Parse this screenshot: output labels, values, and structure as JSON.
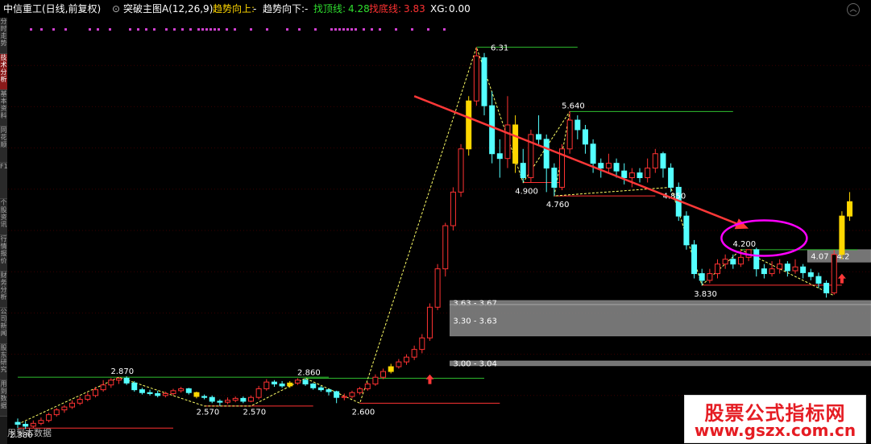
{
  "header": {
    "stock": "中信重工(日线,前复权)",
    "indicator": "突破主图A(12,26,9)",
    "trend_up_label": "趋势向上:",
    "trend_up_value": "-",
    "trend_down_label": "趋势向下:",
    "trend_down_value": "-",
    "top_line_label": "找顶线:",
    "top_line_value": "4.28",
    "bottom_line_label": "找底线:",
    "bottom_line_value": "3.83",
    "xg_label": "XG:",
    "xg_value": "0.00"
  },
  "sidebar_tabs": [
    "分时走势",
    "技术分析",
    "基本资料",
    "同花顺",
    "F10",
    "个股资讯",
    "行情报价",
    "财务分析",
    "公司新闻",
    "股东研究",
    "用到数据"
  ],
  "status_text": "用到本数据",
  "watermark": {
    "line1": "股票公式指标网",
    "line2": "www.gszx.com.cn"
  },
  "colors": {
    "up": "#ff3232",
    "down": "#54ffff",
    "signal": "#ffd700",
    "support": "#ff3232",
    "resistance": "#2fbf2f",
    "zigzag": "#ffff66",
    "arrow": "#ff3838",
    "ellipse": "#ff00ff",
    "box": "#8a8a8a"
  },
  "chart_data": {
    "type": "candlestick",
    "ylim": [
      2.25,
      6.55
    ],
    "candles": [
      [
        2.4,
        2.38,
        2.44,
        2.34
      ],
      [
        2.38,
        2.36,
        2.41,
        2.33
      ],
      [
        2.36,
        2.39,
        2.42,
        2.34
      ],
      [
        2.39,
        2.42,
        2.45,
        2.37
      ],
      [
        2.42,
        2.48,
        2.5,
        2.4
      ],
      [
        2.48,
        2.53,
        2.55,
        2.46
      ],
      [
        2.53,
        2.56,
        2.58,
        2.5
      ],
      [
        2.56,
        2.6,
        2.63,
        2.54
      ],
      [
        2.6,
        2.64,
        2.67,
        2.58
      ],
      [
        2.64,
        2.68,
        2.71,
        2.62
      ],
      [
        2.68,
        2.74,
        2.77,
        2.66
      ],
      [
        2.74,
        2.79,
        2.84,
        2.72
      ],
      [
        2.79,
        2.84,
        2.86,
        2.76
      ],
      [
        2.84,
        2.86,
        2.87,
        2.8
      ],
      [
        2.86,
        2.81,
        2.88,
        2.79
      ],
      [
        2.81,
        2.74,
        2.83,
        2.72
      ],
      [
        2.74,
        2.71,
        2.76,
        2.69
      ],
      [
        2.71,
        2.7,
        2.74,
        2.68
      ],
      [
        2.7,
        2.68,
        2.73,
        2.66
      ],
      [
        2.68,
        2.7,
        2.72,
        2.66
      ],
      [
        2.7,
        2.73,
        2.75,
        2.68
      ],
      [
        2.73,
        2.75,
        2.77,
        2.71
      ],
      [
        2.75,
        2.71,
        2.76,
        2.69
      ],
      [
        2.71,
        2.67,
        2.72,
        2.65
      ],
      [
        2.67,
        2.66,
        2.69,
        2.64
      ],
      [
        2.66,
        2.62,
        2.68,
        2.6
      ],
      [
        2.62,
        2.61,
        2.64,
        2.57
      ],
      [
        2.61,
        2.63,
        2.66,
        2.59
      ],
      [
        2.63,
        2.65,
        2.67,
        2.61
      ],
      [
        2.65,
        2.62,
        2.67,
        2.6
      ],
      [
        2.62,
        2.66,
        2.68,
        2.61
      ],
      [
        2.66,
        2.75,
        2.78,
        2.64
      ],
      [
        2.75,
        2.82,
        2.85,
        2.73
      ],
      [
        2.82,
        2.8,
        2.84,
        2.77
      ],
      [
        2.8,
        2.78,
        2.83,
        2.76
      ],
      [
        2.78,
        2.81,
        2.83,
        2.76
      ],
      [
        2.81,
        2.84,
        2.86,
        2.79
      ],
      [
        2.84,
        2.8,
        2.86,
        2.78
      ],
      [
        2.8,
        2.76,
        2.81,
        2.74
      ],
      [
        2.76,
        2.74,
        2.78,
        2.72
      ],
      [
        2.74,
        2.72,
        2.75,
        2.68
      ],
      [
        2.72,
        2.66,
        2.73,
        2.6
      ],
      [
        2.66,
        2.67,
        2.7,
        2.63
      ],
      [
        2.67,
        2.71,
        2.73,
        2.65
      ],
      [
        2.71,
        2.75,
        2.77,
        2.69
      ],
      [
        2.75,
        2.8,
        2.82,
        2.73
      ],
      [
        2.8,
        2.87,
        2.9,
        2.78
      ],
      [
        2.87,
        2.93,
        2.96,
        2.85
      ],
      [
        2.93,
        2.98,
        3.01,
        2.91
      ],
      [
        2.98,
        3.03,
        3.06,
        2.96
      ],
      [
        3.03,
        3.08,
        3.11,
        3.0
      ],
      [
        3.08,
        3.16,
        3.2,
        3.05
      ],
      [
        3.16,
        3.28,
        3.32,
        3.12
      ],
      [
        3.28,
        3.6,
        3.64,
        3.25
      ],
      [
        3.6,
        4.0,
        4.05,
        3.57
      ],
      [
        4.0,
        4.45,
        4.48,
        3.92
      ],
      [
        4.45,
        4.8,
        4.85,
        4.4
      ],
      [
        4.8,
        5.25,
        5.3,
        4.75
      ],
      [
        5.25,
        5.75,
        5.8,
        5.18
      ],
      [
        5.75,
        6.22,
        6.31,
        5.7
      ],
      [
        6.2,
        5.7,
        6.25,
        5.6
      ],
      [
        5.7,
        5.2,
        5.85,
        5.1
      ],
      [
        5.2,
        5.15,
        5.35,
        4.95
      ],
      [
        5.15,
        5.5,
        5.8,
        5.05
      ],
      [
        5.5,
        5.1,
        5.6,
        5.0
      ],
      [
        5.1,
        4.95,
        5.25,
        4.9
      ],
      [
        4.95,
        5.4,
        5.45,
        4.9
      ],
      [
        5.4,
        5.35,
        5.6,
        5.3
      ],
      [
        5.35,
        5.05,
        5.4,
        4.8
      ],
      [
        5.05,
        4.85,
        5.1,
        4.76
      ],
      [
        4.85,
        5.25,
        5.3,
        4.82
      ],
      [
        5.25,
        5.55,
        5.64,
        5.2
      ],
      [
        5.55,
        5.45,
        5.6,
        5.35
      ],
      [
        5.45,
        5.3,
        5.5,
        5.2
      ],
      [
        5.3,
        5.1,
        5.35,
        5.0
      ],
      [
        5.1,
        5.05,
        5.15,
        4.95
      ],
      [
        5.05,
        5.1,
        5.2,
        5.0
      ],
      [
        5.1,
        5.02,
        5.15,
        4.95
      ],
      [
        5.02,
        4.95,
        5.1,
        4.88
      ],
      [
        4.95,
        5.0,
        5.05,
        4.85
      ],
      [
        5.0,
        4.95,
        5.05,
        4.9
      ],
      [
        4.95,
        5.05,
        5.15,
        4.9
      ],
      [
        5.05,
        5.2,
        5.25,
        5.0
      ],
      [
        5.2,
        5.05,
        5.22,
        4.95
      ],
      [
        5.05,
        4.85,
        5.1,
        4.8
      ],
      [
        4.85,
        4.55,
        4.9,
        4.5
      ],
      [
        4.55,
        4.25,
        4.6,
        4.2
      ],
      [
        4.25,
        3.95,
        4.3,
        3.9
      ],
      [
        3.95,
        3.88,
        4.0,
        3.83
      ],
      [
        3.88,
        3.95,
        4.0,
        3.85
      ],
      [
        3.95,
        4.05,
        4.1,
        3.9
      ],
      [
        4.05,
        4.1,
        4.15,
        4.0
      ],
      [
        4.1,
        4.05,
        4.15,
        4.0
      ],
      [
        4.05,
        4.12,
        4.2,
        4.02
      ],
      [
        4.12,
        4.2,
        4.2,
        4.08
      ],
      [
        4.2,
        4.0,
        4.22,
        3.92
      ],
      [
        4.0,
        3.95,
        4.05,
        3.9
      ],
      [
        3.95,
        4.0,
        4.08,
        3.92
      ],
      [
        4.0,
        4.05,
        4.1,
        3.95
      ],
      [
        4.05,
        3.98,
        4.08,
        3.92
      ],
      [
        3.98,
        4.02,
        4.1,
        3.95
      ],
      [
        4.02,
        3.96,
        4.05,
        3.9
      ],
      [
        3.96,
        3.92,
        4.0,
        3.88
      ],
      [
        3.92,
        3.85,
        3.96,
        3.8
      ],
      [
        3.85,
        3.75,
        3.88,
        3.7
      ],
      [
        3.75,
        4.15,
        4.2,
        3.73
      ],
      [
        4.15,
        4.55,
        4.6,
        4.1
      ],
      [
        4.55,
        4.7,
        4.8,
        4.5
      ]
    ],
    "signal_candles": [
      23,
      35,
      48,
      58,
      64,
      106,
      107
    ],
    "price_labels": [
      {
        "text": "2.380",
        "i": 0,
        "p": 2.36,
        "pos": "below"
      },
      {
        "text": "2.870",
        "i": 13,
        "p": 2.87,
        "pos": "above"
      },
      {
        "text": "2.570",
        "i": 24,
        "p": 2.6,
        "pos": "below"
      },
      {
        "text": "2.570",
        "i": 30,
        "p": 2.6,
        "pos": "below"
      },
      {
        "text": "2.860",
        "i": 37,
        "p": 2.86,
        "pos": "above"
      },
      {
        "text": "2.600",
        "i": 44,
        "p": 2.6,
        "pos": "below"
      },
      {
        "text": "6.31",
        "i": 60,
        "p": 6.31,
        "pos": "right"
      },
      {
        "text": "4.900",
        "i": 65,
        "p": 4.9,
        "pos": "below"
      },
      {
        "text": "5.640",
        "i": 71,
        "p": 5.64,
        "pos": "above"
      },
      {
        "text": "4.760",
        "i": 69,
        "p": 4.76,
        "pos": "below"
      },
      {
        "text": "4.850",
        "i": 84,
        "p": 4.85,
        "pos": "below"
      },
      {
        "text": "4.200",
        "i": 93,
        "p": 4.2,
        "pos": "above"
      },
      {
        "text": "3.830",
        "i": 88,
        "p": 3.83,
        "pos": "below"
      }
    ],
    "zigzag": [
      [
        0,
        2.38
      ],
      [
        13,
        2.87
      ],
      [
        24,
        2.57
      ],
      [
        30,
        2.57
      ],
      [
        37,
        2.86
      ],
      [
        44,
        2.6
      ],
      [
        59,
        6.31
      ],
      [
        65,
        4.9
      ],
      [
        71,
        5.64
      ],
      [
        69,
        4.76
      ],
      [
        84,
        4.85
      ],
      [
        88,
        3.83
      ],
      [
        93,
        4.2
      ],
      [
        105,
        3.72
      ]
    ],
    "resistance_lines": [
      [
        0,
        2.87,
        40
      ],
      [
        37,
        2.86,
        60
      ],
      [
        59,
        6.31,
        72
      ],
      [
        71,
        5.64,
        92
      ],
      [
        93,
        4.2,
        108
      ]
    ],
    "support_lines": [
      [
        0,
        2.34,
        20
      ],
      [
        24,
        2.57,
        38
      ],
      [
        44,
        2.6,
        62
      ],
      [
        65,
        4.9,
        70
      ],
      [
        69,
        4.76,
        82
      ],
      [
        88,
        3.83,
        106
      ]
    ],
    "price_zones": [
      {
        "label": "3.63 - 3.67",
        "low": 3.63,
        "high": 3.67,
        "from": 56
      },
      {
        "label": "3.30 - 3.63",
        "low": 3.3,
        "high": 3.63,
        "from": 56
      },
      {
        "label": "3.00 - 3.04",
        "low": 3.0,
        "high": 3.04,
        "from": 56
      },
      {
        "label": "4.07 - 4.2",
        "low": 4.07,
        "high": 4.2,
        "from": 102
      }
    ],
    "buy_arrows": [
      [
        53,
        2.95
      ],
      [
        106,
        4.0
      ]
    ],
    "trend_arrow": {
      "from": [
        51,
        5.8
      ],
      "to": [
        94,
        4.42
      ]
    },
    "ellipse_center": [
      96,
      4.32
    ],
    "marker_dots_row": [
      27,
      40,
      55,
      70,
      100,
      110,
      125,
      150,
      160,
      170,
      180,
      195,
      205,
      215,
      225,
      235,
      240,
      245,
      250,
      255,
      260,
      270,
      280,
      300,
      320,
      345,
      360,
      380,
      400,
      405,
      410,
      415,
      420,
      425,
      430,
      440,
      450,
      460,
      480,
      500,
      520,
      540
    ]
  }
}
